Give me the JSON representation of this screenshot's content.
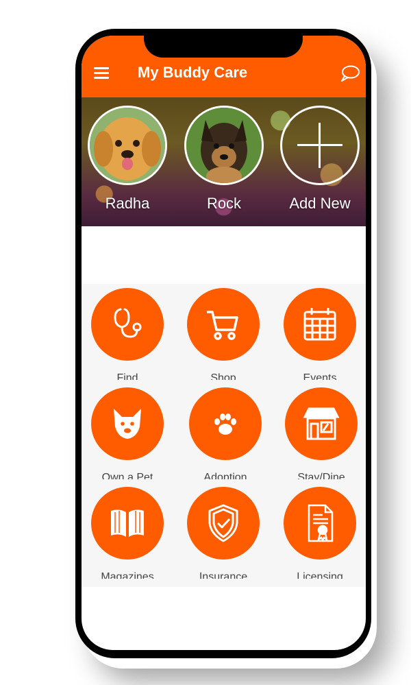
{
  "header": {
    "title": "My Buddy Care",
    "menu_icon": "hamburger-menu-icon",
    "chat_icon": "chat-bubble-icon"
  },
  "pets": [
    {
      "name": "Radha"
    },
    {
      "name": "Rock"
    }
  ],
  "add_pet": {
    "label": "Add New"
  },
  "menu": [
    {
      "label": "Find",
      "icon": "stethoscope-icon"
    },
    {
      "label": "Shop",
      "icon": "shopping-cart-icon"
    },
    {
      "label": "Events",
      "icon": "calendar-icon"
    },
    {
      "label": "Own a Pet",
      "icon": "dog-face-icon"
    },
    {
      "label": "Adoption",
      "icon": "paw-icon"
    },
    {
      "label": "Stay/Dine",
      "icon": "storefront-icon"
    },
    {
      "label": "Magazines",
      "icon": "open-book-icon"
    },
    {
      "label": "Insurance",
      "icon": "shield-check-icon"
    },
    {
      "label": "Licensing",
      "icon": "certificate-icon"
    }
  ],
  "colors": {
    "accent": "#FF5C00",
    "background": "#f6f6f6"
  }
}
